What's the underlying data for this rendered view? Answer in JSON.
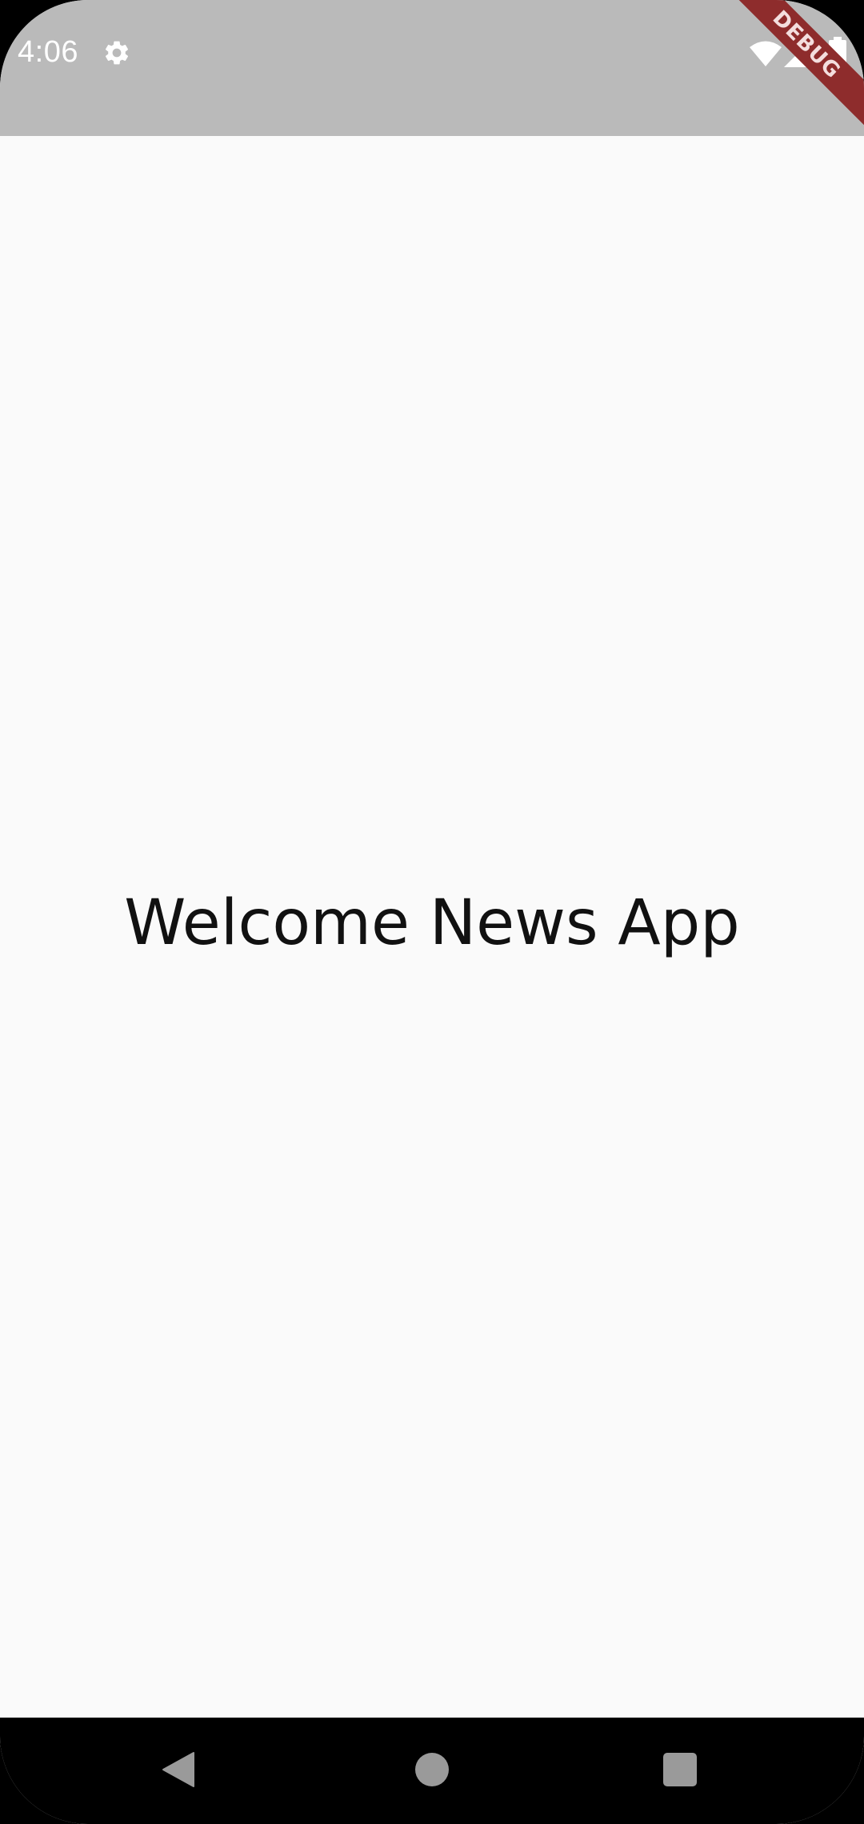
{
  "status_bar": {
    "time": "4:06",
    "background": "#bababa",
    "icons": [
      "gear-icon",
      "wifi-icon",
      "signal-icon",
      "battery-icon"
    ]
  },
  "debug_banner": {
    "label": "DEBUG",
    "color": "#8e2c2c"
  },
  "main": {
    "welcome_text": "Welcome News App",
    "background": "#fafafa"
  },
  "nav_bar": {
    "buttons": [
      "back-icon",
      "home-icon",
      "recents-icon"
    ],
    "background": "#000000"
  }
}
